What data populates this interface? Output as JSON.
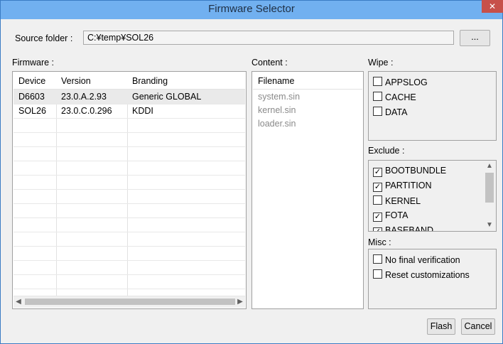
{
  "window": {
    "title": "Firmware Selector",
    "close_glyph": "✕"
  },
  "source": {
    "label": "Source folder :",
    "path": "C:¥temp¥SOL26",
    "browse_label": "..."
  },
  "firmware": {
    "label": "Firmware :",
    "columns": [
      "Device",
      "Version",
      "Branding"
    ],
    "rows": [
      {
        "device": "D6603",
        "version": "23.0.A.2.93",
        "branding": "Generic GLOBAL"
      },
      {
        "device": "SOL26",
        "version": "23.0.C.0.296",
        "branding": "KDDI"
      }
    ],
    "scroll_left": "◀",
    "scroll_right": "▶"
  },
  "content": {
    "label": "Content :",
    "header": "Filename",
    "files": [
      "system.sin",
      "kernel.sin",
      "loader.sin"
    ]
  },
  "wipe": {
    "label": "Wipe :",
    "items": [
      {
        "label": "APPSLOG",
        "checked": false
      },
      {
        "label": "CACHE",
        "checked": false
      },
      {
        "label": "DATA",
        "checked": false
      }
    ]
  },
  "exclude": {
    "label": "Exclude :",
    "items": [
      {
        "label": "BOOTBUNDLE",
        "checked": true
      },
      {
        "label": "PARTITION",
        "checked": true
      },
      {
        "label": "KERNEL",
        "checked": false
      },
      {
        "label": "FOTA",
        "checked": true
      },
      {
        "label": "BASEBAND",
        "checked": true
      }
    ],
    "scroll_up": "▲",
    "scroll_down": "▼"
  },
  "misc": {
    "label": "Misc :",
    "items": [
      {
        "label": "No final verification",
        "checked": false
      },
      {
        "label": "Reset customizations",
        "checked": false
      }
    ]
  },
  "actions": {
    "flash_label": "Flash",
    "cancel_label": "Cancel"
  }
}
